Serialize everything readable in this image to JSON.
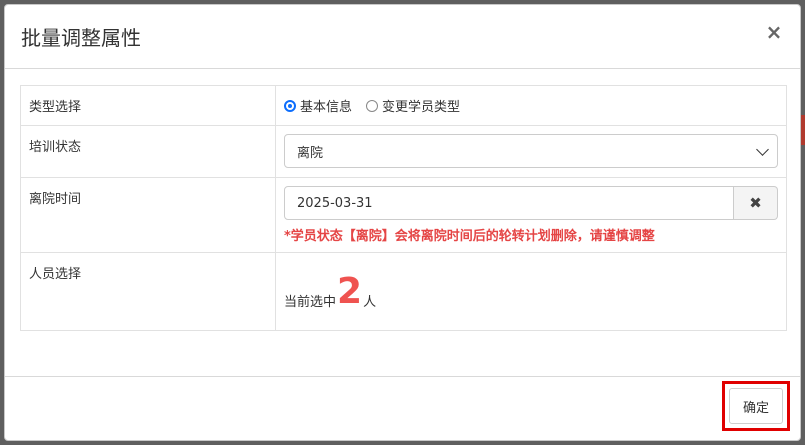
{
  "dialog": {
    "title": "批量调整属性",
    "close_label": "×"
  },
  "form": {
    "type_row": {
      "label": "类型选择",
      "options": [
        "基本信息",
        "变更学员类型"
      ],
      "selected": "基本信息"
    },
    "status_row": {
      "label": "培训状态",
      "selected": "离院"
    },
    "time_row": {
      "label": "离院时间",
      "value": "2025-03-31",
      "clear_label": "✖",
      "warning": "*学员状态【离院】会将离院时间后的轮转计划删除，请谨慎调整"
    },
    "people_row": {
      "label": "人员选择",
      "prefix": "当前选中",
      "count": "2",
      "suffix": "人"
    }
  },
  "footer": {
    "confirm_label": "确定"
  },
  "colors": {
    "accent": "#0d6efd",
    "warning": "#e54545",
    "count": "#ef5350",
    "highlight": "#e00000"
  }
}
